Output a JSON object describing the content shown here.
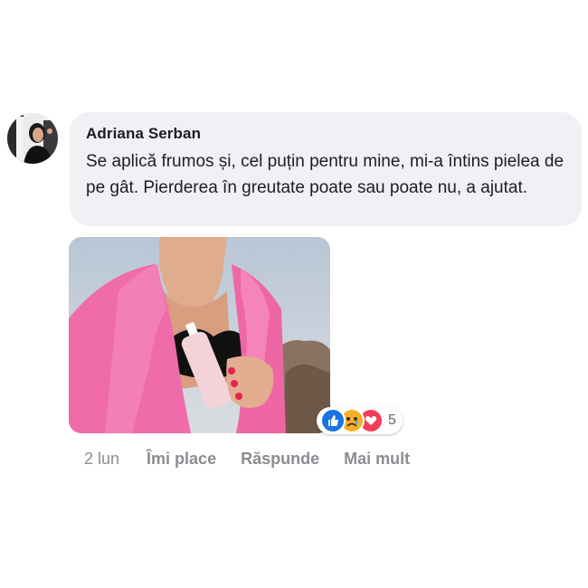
{
  "comment": {
    "author": "Adriana Serban",
    "text": "Se aplică frumos și, cel puțin pentru mine, mi-a întins pielea de pe gât. Pierderea în greutate poate sau poate nu, a ajutat.",
    "reactions": {
      "icons": [
        "like-icon",
        "sad-icon",
        "love-icon"
      ],
      "count": "5"
    },
    "actions": {
      "time": "2 lun",
      "like": "Îmi place",
      "reply": "Răspunde",
      "more": "Mai mult"
    }
  },
  "colors": {
    "bubble": "#eff1f4",
    "like": "#1b74e4",
    "love": "#f33e58",
    "sad": "#f7b125",
    "meta_text": "#8a8d91"
  }
}
